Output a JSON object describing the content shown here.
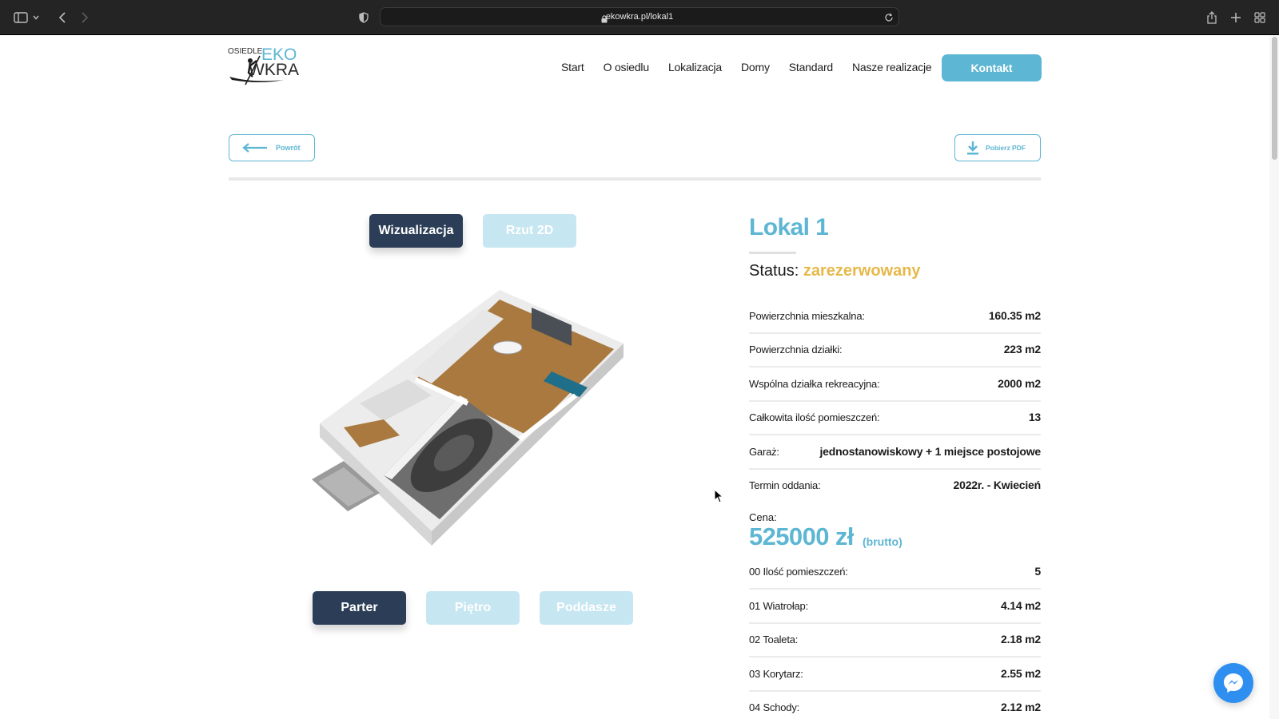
{
  "browser": {
    "url": "ekowkra.pl/lokal1",
    "icons": [
      "sidebar-icon",
      "chevron-down-icon",
      "back-icon",
      "forward-icon",
      "shield-icon",
      "lock-icon",
      "reload-icon",
      "share-icon",
      "new-tab-icon",
      "tab-overview-icon"
    ]
  },
  "site": {
    "logo": {
      "top": "OSIEDLE",
      "eko": "EKO",
      "wkra": "WKRA"
    },
    "nav": [
      "Start",
      "O osiedlu",
      "Lokalizacja",
      "Domy",
      "Standard",
      "Nasze realizacje"
    ],
    "contact_label": "Kontakt",
    "accent": "#5db6d3",
    "dark": "#2c3e57"
  },
  "toolbar": {
    "back_label": "Powrót",
    "pdf_label": "Pobierz PDF"
  },
  "viewer": {
    "view_tabs": [
      "Wizualizacja",
      "Rzut 2D"
    ],
    "active_view": "Wizualizacja",
    "floor_tabs": [
      "Parter",
      "Piętro",
      "Poddasze"
    ],
    "active_floor": "Parter"
  },
  "details": {
    "title": "Lokal 1",
    "status_label": "Status:",
    "status_value": "zarezerwowany",
    "status_color": "#e6b84a",
    "specs": [
      {
        "label": "Powierzchnia mieszkalna:",
        "value": "160.35 m2"
      },
      {
        "label": "Powierzchnia działki:",
        "value": "223 m2"
      },
      {
        "label": "Wspólna działka rekreacyjna:",
        "value": "2000 m2"
      },
      {
        "label": "Całkowita ilość pomieszczeń:",
        "value": "13"
      },
      {
        "label": "Garaż:",
        "value": "jednostanowiskowy + 1 miejsce postojowe"
      },
      {
        "label": "Termin oddania:",
        "value": "2022r. - Kwiecień"
      }
    ],
    "price_label": "Cena:",
    "price_value": "525000 zł",
    "price_note": "(brutto)",
    "rooms": [
      {
        "label": "00 Ilość pomieszczeń:",
        "value": "5"
      },
      {
        "label": "01 Wiatrołap:",
        "value": "4.14 m2"
      },
      {
        "label": "02 Toaleta:",
        "value": "2.18 m2"
      },
      {
        "label": "03 Korytarz:",
        "value": "2.55 m2"
      },
      {
        "label": "04 Schody:",
        "value": "2.12 m2"
      }
    ]
  }
}
